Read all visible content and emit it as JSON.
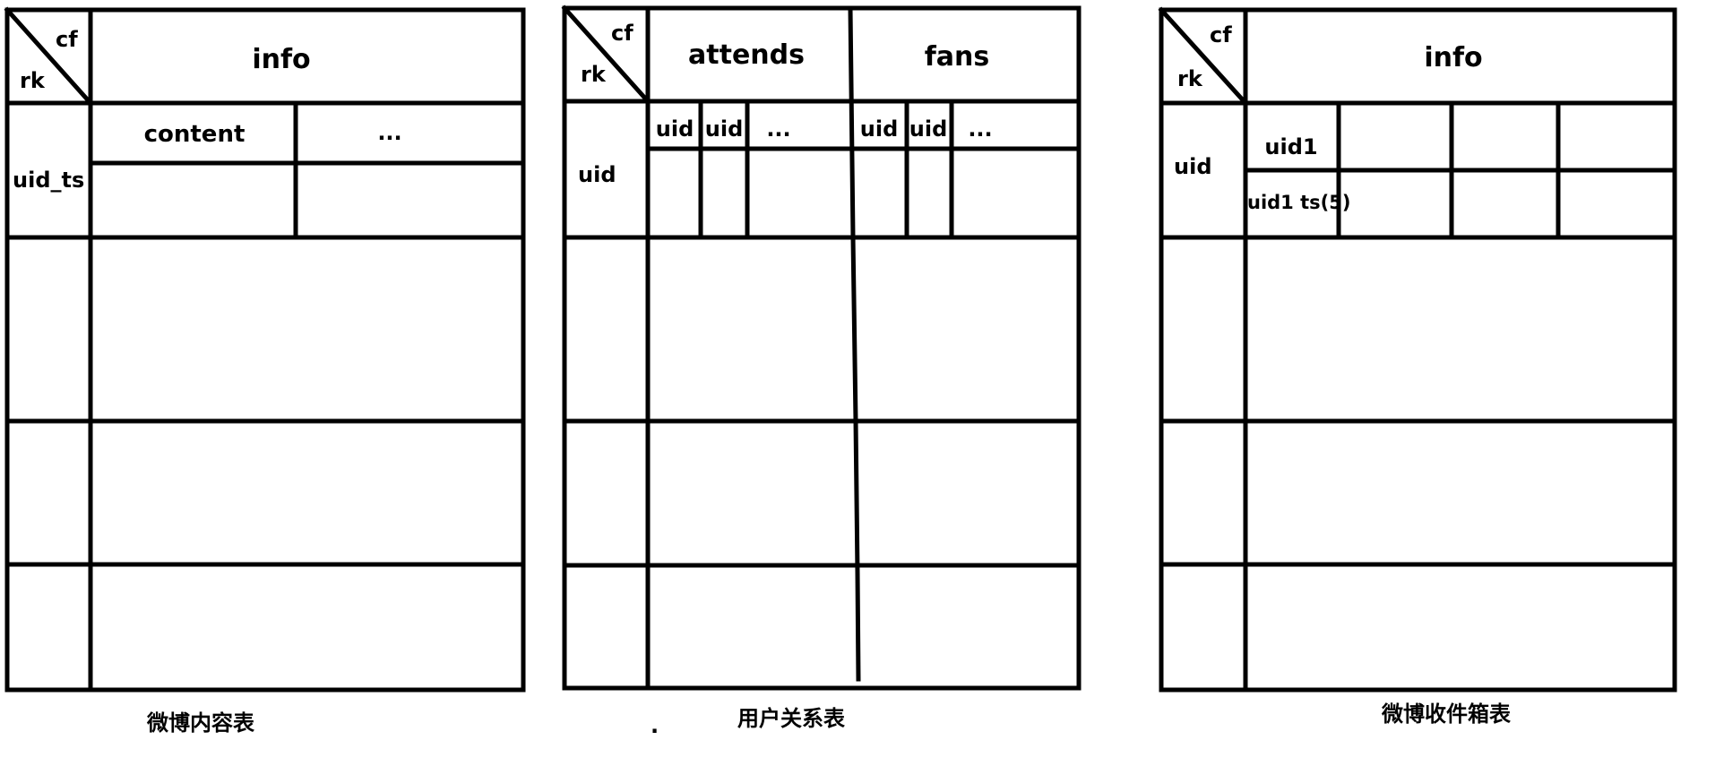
{
  "tables": [
    {
      "caption": "微博内容表",
      "corner": {
        "cf": "cf",
        "rk": "rk"
      },
      "family": "info",
      "row_key": "uid_ts",
      "columns": [
        "content",
        "..."
      ]
    },
    {
      "caption": "用户关系表",
      "corner": {
        "cf": "cf",
        "rk": "rk"
      },
      "families": [
        "attends",
        "fans"
      ],
      "row_key": "uid",
      "attends_columns": [
        "uid",
        "uid",
        "..."
      ],
      "fans_columns": [
        "uid",
        "uid",
        "..."
      ]
    },
    {
      "caption": "微博收件箱表",
      "corner": {
        "cf": "cf",
        "rk": "rk"
      },
      "family": "info",
      "row_key": "uid",
      "column": "uid1",
      "cell_value": "uid1  ts(5)"
    }
  ],
  "dot": "."
}
